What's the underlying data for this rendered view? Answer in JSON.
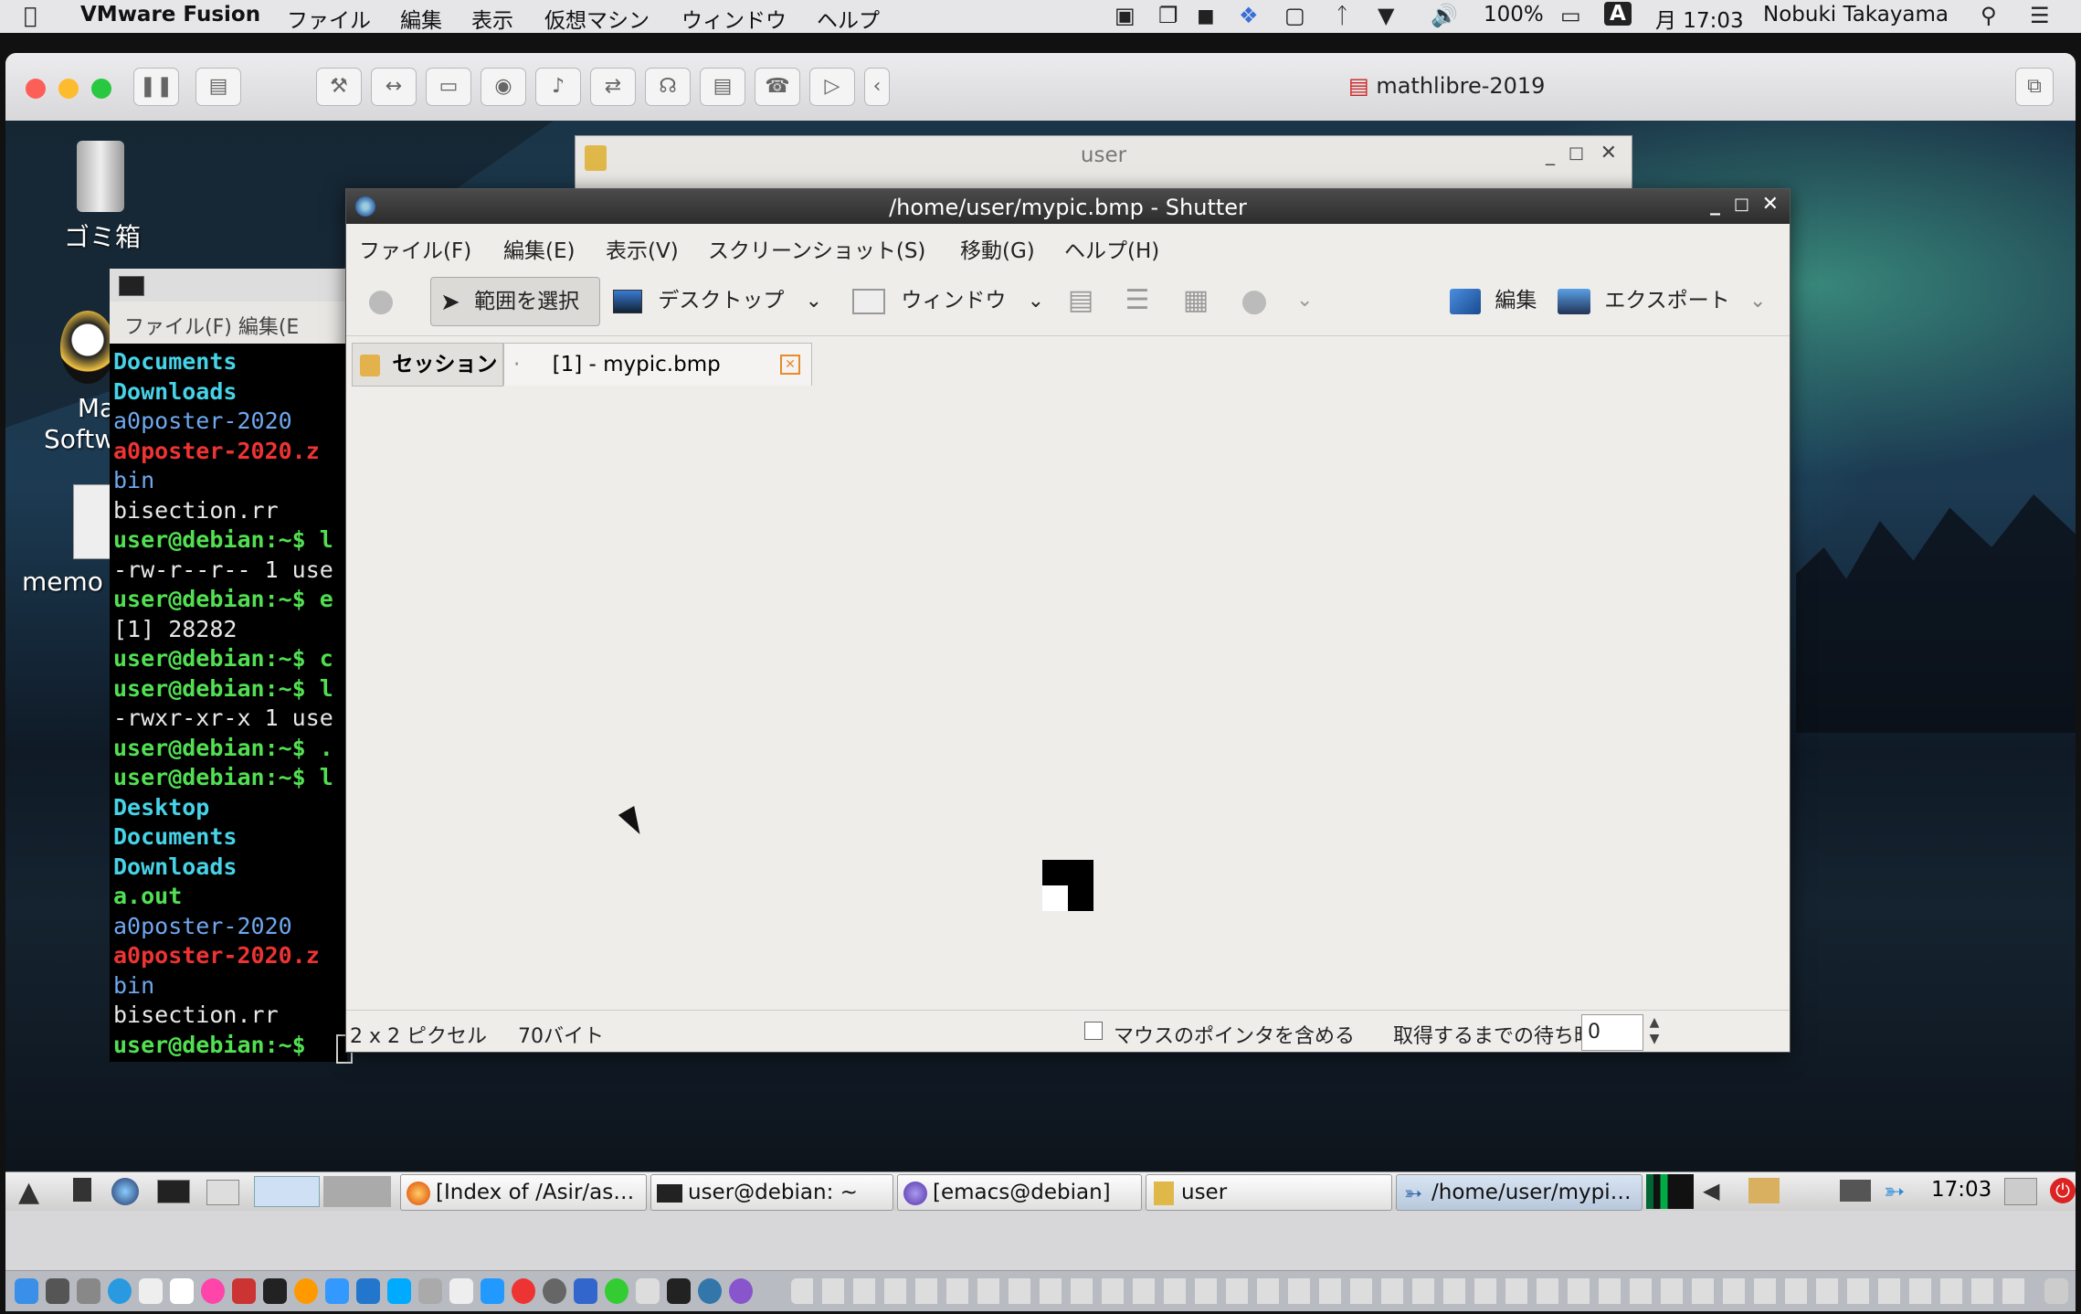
{
  "mac_menubar": {
    "app": "VMware Fusion",
    "menus": [
      "ファイル",
      "編集",
      "表示",
      "仮想マシン",
      "ウィンドウ",
      "ヘルプ"
    ],
    "battery": "100%",
    "input_mode": "A",
    "clock": "月 17:03",
    "user": "Nobuki Takayama"
  },
  "vmware": {
    "title": "mathlibre-2019"
  },
  "desktop": {
    "icons": [
      {
        "label": "ゴミ箱"
      },
      {
        "label": "Ma\nSoftw"
      },
      {
        "label": "memo"
      }
    ]
  },
  "user_window": {
    "title": "user"
  },
  "terminal": {
    "menu": "ファイル(F)   編集(E",
    "lines": [
      {
        "text": "Documents",
        "cls": "c-cyan"
      },
      {
        "text": "Downloads",
        "cls": "c-cyan"
      },
      {
        "text": "a0poster-2020",
        "cls": "c-blue"
      },
      {
        "text": "a0poster-2020.z",
        "cls": "c-red"
      },
      {
        "text": "bin",
        "cls": "c-blue"
      },
      {
        "text": "bisection.rr",
        "cls": "c-white"
      },
      {
        "text": "user@debian:~$ l",
        "cls": "c-green"
      },
      {
        "text": "-rw-r--r-- 1 use",
        "cls": "c-white"
      },
      {
        "text": "user@debian:~$ e",
        "cls": "c-green"
      },
      {
        "text": "[1] 28282",
        "cls": "c-white"
      },
      {
        "text": "user@debian:~$ c",
        "cls": "c-green"
      },
      {
        "text": "user@debian:~$ l",
        "cls": "c-green"
      },
      {
        "text": "-rwxr-xr-x 1 use",
        "cls": "c-white"
      },
      {
        "text": "user@debian:~$ .",
        "cls": "c-green"
      },
      {
        "text": "user@debian:~$ l",
        "cls": "c-green"
      },
      {
        "text": "Desktop",
        "cls": "c-cyan"
      },
      {
        "text": "Documents",
        "cls": "c-cyan"
      },
      {
        "text": "Downloads",
        "cls": "c-cyan"
      },
      {
        "text": "a.out",
        "cls": "c-green"
      },
      {
        "text": "a0poster-2020",
        "cls": "c-blue"
      },
      {
        "text": "a0poster-2020.z",
        "cls": "c-red"
      },
      {
        "text": "bin",
        "cls": "c-blue"
      },
      {
        "text": "bisection.rr",
        "cls": "c-white"
      },
      {
        "text": "user@debian:~$ ",
        "cls": "c-green"
      }
    ]
  },
  "shutter": {
    "title": "/home/user/mypic.bmp - Shutter",
    "menu": [
      "ファイル(F)",
      "編集(E)",
      "表示(V)",
      "スクリーンショット(S)",
      "移動(G)",
      "ヘルプ(H)"
    ],
    "toolbar": {
      "select": "範囲を選択",
      "desktop": "デスクトップ",
      "window": "ウィンドウ",
      "edit": "編集",
      "export": "エクスポート"
    },
    "tabs": {
      "session": "セッション",
      "file": "[1] - mypic.bmp"
    },
    "status": {
      "size": "2 x 2 ピクセル",
      "bytes": "70バイト",
      "include_pointer": "マウスのポインタを含める",
      "delay_label": "取得するまでの待ち時間:",
      "delay_value": "0"
    }
  },
  "taskbar": {
    "tasks": [
      "[Index of /Asir/as…",
      "user@debian: ~",
      "[emacs@debian]",
      "user",
      "/home/user/mypi…"
    ],
    "clock": "17:03"
  }
}
